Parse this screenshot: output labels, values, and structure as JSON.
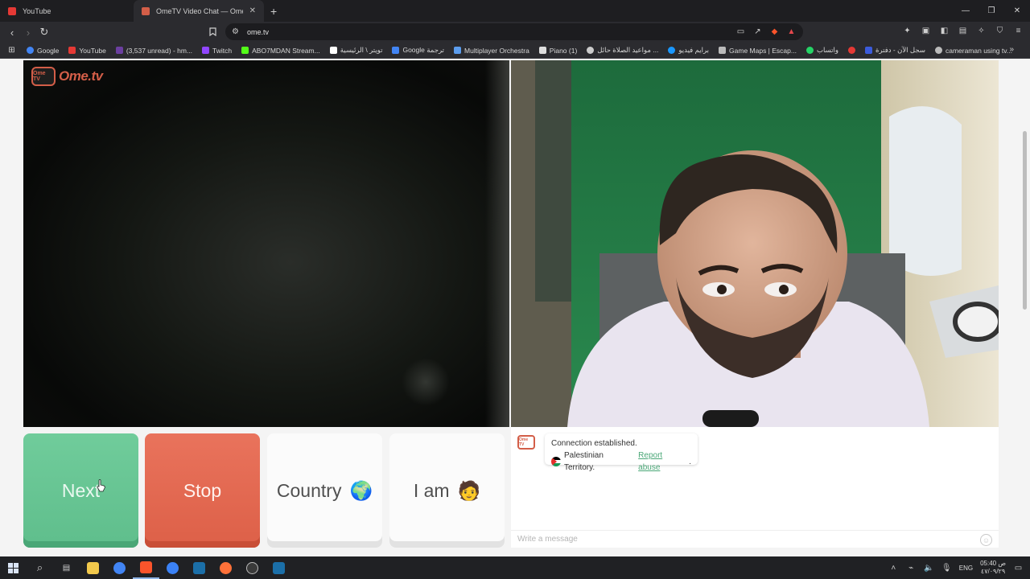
{
  "browser": {
    "tabs": [
      {
        "title": "YouTube",
        "active": false,
        "color": "#e53935"
      },
      {
        "title": "OmeTV Video Chat — Omegl",
        "active": true,
        "color": "#d35e48"
      }
    ],
    "new_tab_glyph": "+",
    "address": "ome.tv",
    "window_controls": [
      "—",
      "❐",
      "✕"
    ]
  },
  "bookmarks": [
    {
      "label": "Google",
      "color": "#4285f4"
    },
    {
      "label": "YouTube",
      "color": "#e53935"
    },
    {
      "label": "(3,537 unread) - hm...",
      "color": "#6b3fa0"
    },
    {
      "label": "Twitch",
      "color": "#9146ff"
    },
    {
      "label": "ABO7MDAN Stream...",
      "color": "#53fc18"
    },
    {
      "label": "تويتر \\ الرئيسية",
      "color": "#ffffff"
    },
    {
      "label": "Google ترجمة",
      "color": "#4285f4"
    },
    {
      "label": "Multiplayer Orchestra",
      "color": "#5c9ded"
    },
    {
      "label": "Piano (1)",
      "color": "#dddddd"
    },
    {
      "label": "مواعيد الصلاة حائل ...",
      "color": "#cccccc"
    },
    {
      "label": "برايم فيديو",
      "color": "#1a98ff"
    },
    {
      "label": "Game Maps | Escap...",
      "color": "#bbbbbb"
    },
    {
      "label": "واتساب",
      "color": "#25d366"
    },
    {
      "label": "",
      "color": "#e53935"
    },
    {
      "label": "سجل الآن - دفترة",
      "color": "#3b5bdb"
    },
    {
      "label": "cameraman using tv...",
      "color": "#bbbbbb"
    }
  ],
  "bookmarks_more": "»",
  "page": {
    "logo_box": "Ome TV",
    "logo_text": "Ome.tv",
    "buttons": {
      "next": "Next",
      "stop": "Stop",
      "country": "Country",
      "country_emoji": "🌍",
      "iam": "I am",
      "iam_emoji": "🧑"
    },
    "chat": {
      "bot_icon": "Ome TV",
      "message_line1": "Connection established.",
      "country": "Palestinian Territory.",
      "report_link": "Report abuse",
      "period": ".",
      "input_placeholder": "Write a message",
      "emoji_glyph": "☺"
    }
  },
  "taskbar": {
    "language": "ENG",
    "time": "05:40 ص",
    "date": "٤٧/٠٩/٢٩"
  },
  "colors": {
    "accent_green": "#5fbe8c",
    "accent_red": "#dd6048",
    "brand": "#d35e48"
  }
}
